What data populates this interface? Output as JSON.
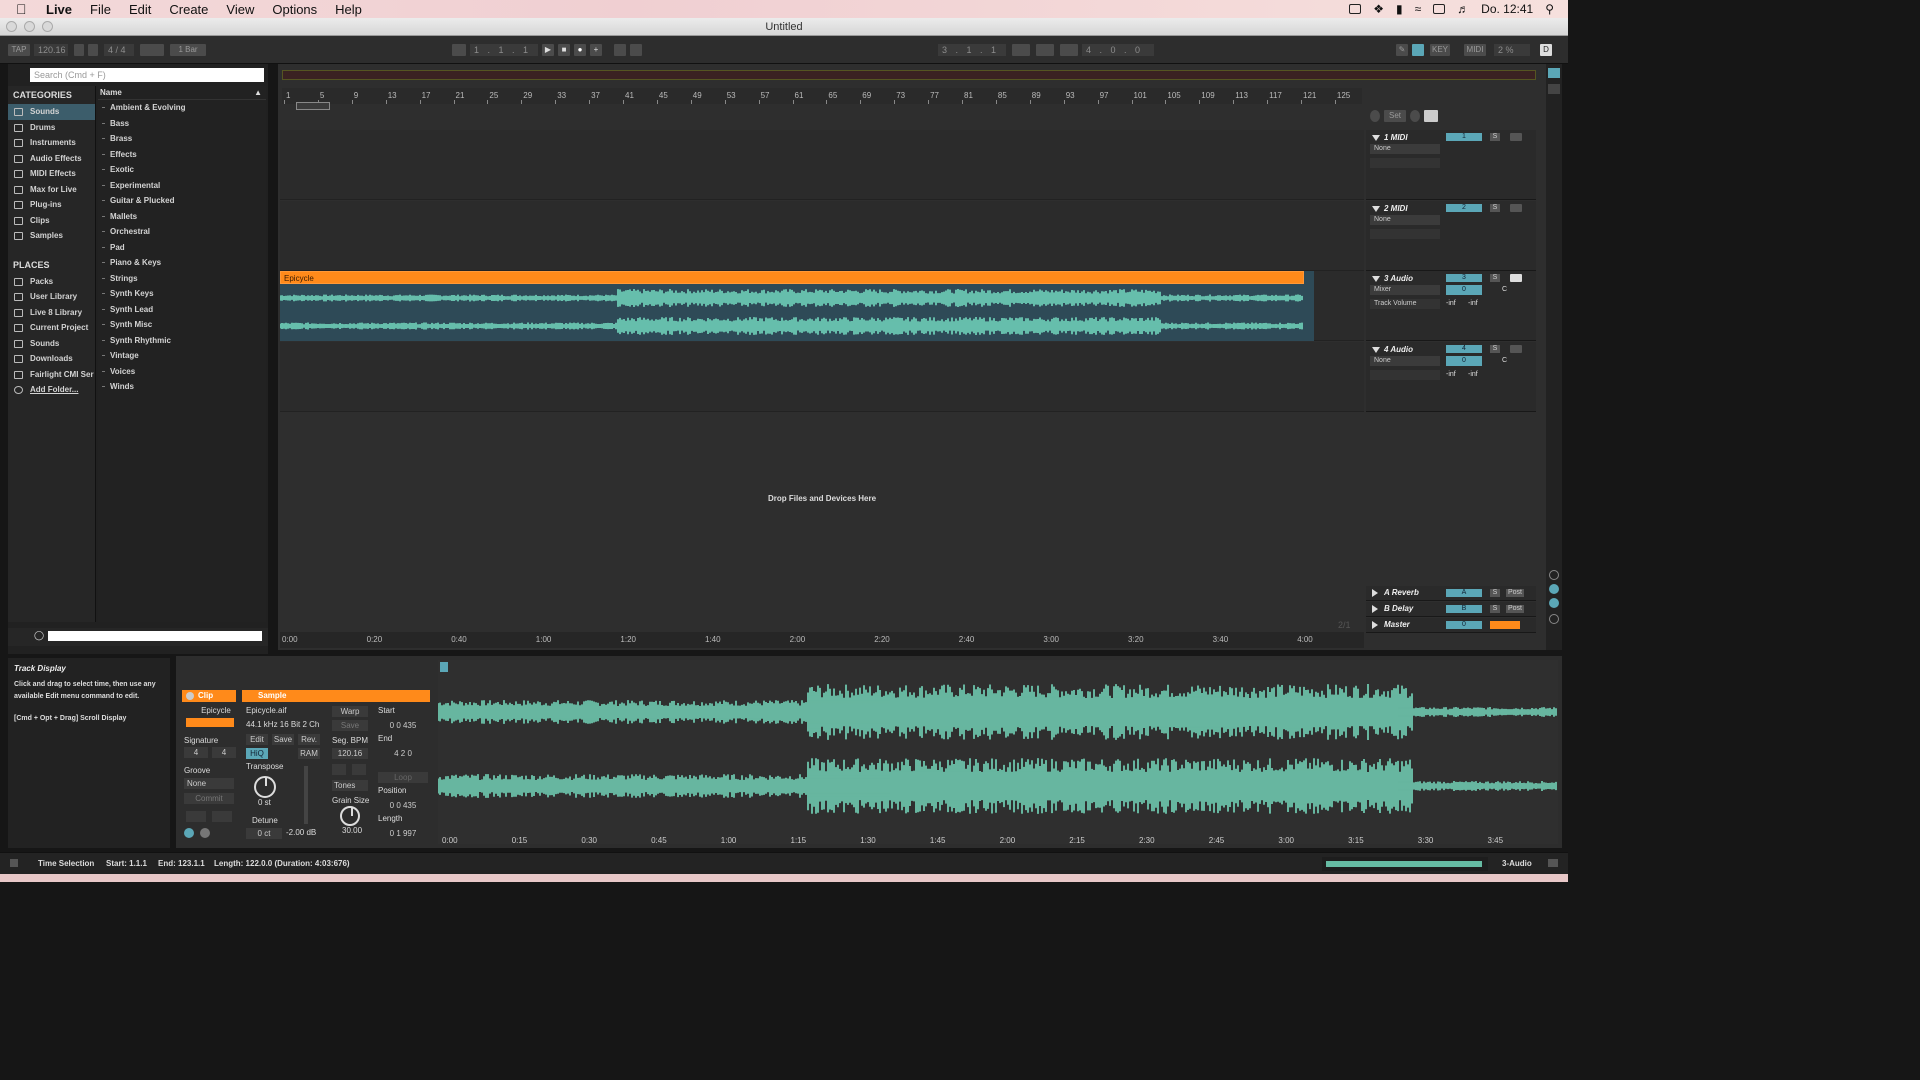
{
  "menubar": {
    "menus": [
      "Live",
      "File",
      "Edit",
      "Create",
      "View",
      "Options",
      "Help"
    ],
    "clock": "Do. 12:41"
  },
  "window": {
    "title": "Untitled"
  },
  "control_bar": {
    "tap": "TAP",
    "tempo": "120.16",
    "signature": "4 / 4",
    "quantize": "1 Bar",
    "position": "1 . 1 . 1",
    "loop_start": "3 . 1 . 1",
    "loop_length": "4 . 0 . 0",
    "key": "KEY",
    "midi": "MIDI",
    "cpu": "2 %",
    "d": "D"
  },
  "browser": {
    "search_placeholder": "Search (Cmd + F)",
    "categories_header": "CATEGORIES",
    "categories": [
      "Sounds",
      "Drums",
      "Instruments",
      "Audio Effects",
      "MIDI Effects",
      "Max for Live",
      "Plug-ins",
      "Clips",
      "Samples"
    ],
    "places_header": "PLACES",
    "places": [
      "Packs",
      "User Library",
      "Live 8 Library",
      "Current Project",
      "Sounds",
      "Downloads",
      "Fairlight CMI Ser",
      "Add Folder..."
    ],
    "name_header": "Name",
    "names": [
      "Ambient & Evolving",
      "Bass",
      "Brass",
      "Effects",
      "Exotic",
      "Experimental",
      "Guitar & Plucked",
      "Mallets",
      "Orchestral",
      "Pad",
      "Piano & Keys",
      "Strings",
      "Synth Keys",
      "Synth Lead",
      "Synth Misc",
      "Synth Rhythmic",
      "Vintage",
      "Voices",
      "Winds"
    ]
  },
  "arrangement": {
    "bar_numbers": [
      "1",
      "5",
      "9",
      "13",
      "17",
      "21",
      "25",
      "29",
      "33",
      "37",
      "41",
      "45",
      "49",
      "53",
      "57",
      "61",
      "65",
      "69",
      "73",
      "77",
      "81",
      "85",
      "89",
      "93",
      "97",
      "101",
      "105",
      "109",
      "113",
      "117",
      "121",
      "125"
    ],
    "clip_name": "Epicycle",
    "drop_text": "Drop Files and Devices Here",
    "time_labels": [
      "0:00",
      "0:20",
      "0:40",
      "1:00",
      "1:20",
      "1:40",
      "2:00",
      "2:20",
      "2:40",
      "3:00",
      "3:20",
      "3:40",
      "4:00"
    ],
    "page": "2/1",
    "set_label": "Set"
  },
  "tracks": [
    {
      "name": "1 MIDI",
      "num": "1",
      "input": "None"
    },
    {
      "name": "2 MIDI",
      "num": "2",
      "input": "None"
    },
    {
      "name": "3 Audio",
      "num": "3",
      "input": "Mixer",
      "auto": "Track Volume",
      "vol": "0",
      "pan": "C",
      "inf1": "-inf",
      "inf2": "-inf"
    },
    {
      "name": "4 Audio",
      "num": "4",
      "input": "None",
      "vol": "0",
      "pan": "C",
      "inf1": "-inf",
      "inf2": "-inf"
    }
  ],
  "returns": [
    {
      "name": "A Reverb",
      "num": "A",
      "post": "Post"
    },
    {
      "name": "B Delay",
      "num": "B",
      "post": "Post"
    },
    {
      "name": "Master",
      "num": "0"
    }
  ],
  "solo_label": "S",
  "info_view": {
    "title": "Track Display",
    "body": "Click and drag to select time, then use any available Edit menu command to edit.",
    "hint": "[Cmd + Opt + Drag] Scroll Display"
  },
  "clip_view": {
    "clip_tab": "Clip",
    "sample_tab": "Sample",
    "clip_name": "Epicycle",
    "signature_label": "Signature",
    "sig_num": "4",
    "sig_den": "4",
    "groove_label": "Groove",
    "groove_value": "None",
    "commit": "Commit",
    "file": "Epicycle.aif",
    "format": "44.1 kHz 16 Bit 2 Ch",
    "warp": "Warp",
    "save": "Save",
    "rev": "Rev.",
    "edit": "Edit",
    "hiq": "HiQ",
    "ram": "RAM",
    "seg_bpm_label": "Seg. BPM",
    "seg_bpm": "120.16",
    "transpose_label": "Transpose",
    "transpose_value": "0 st",
    "detune_label": "Detune",
    "detune_value": "0 ct",
    "gain_value": "-2.00 dB",
    "tones": "Tones",
    "grain_label": "Grain Size",
    "grain_value": "30.00",
    "start_label": "Start",
    "start_value": "0   0  435",
    "end_label": "End",
    "end_value": "4   2   0",
    "loop": "Loop",
    "position_label": "Position",
    "position_value": "0   0  435",
    "length_label": "Length",
    "length_value": "0   1  997",
    "time_labels": [
      "0:00",
      "0:15",
      "0:30",
      "0:45",
      "1:00",
      "1:15",
      "1:30",
      "1:45",
      "2:00",
      "2:15",
      "2:30",
      "2:45",
      "3:00",
      "3:15",
      "3:30",
      "3:45"
    ]
  },
  "status": {
    "mode": "Time Selection",
    "start": "Start: 1.1.1",
    "end": "End: 123.1.1",
    "length": "Length: 122.0.0  (Duration: 4:03:676)",
    "track": "3-Audio"
  },
  "colors": {
    "clip_orange": "#ff8a1a",
    "waveform": "#7ff0d0",
    "track_blue": "#5ba7b7",
    "selection": "#3c5d6b"
  }
}
